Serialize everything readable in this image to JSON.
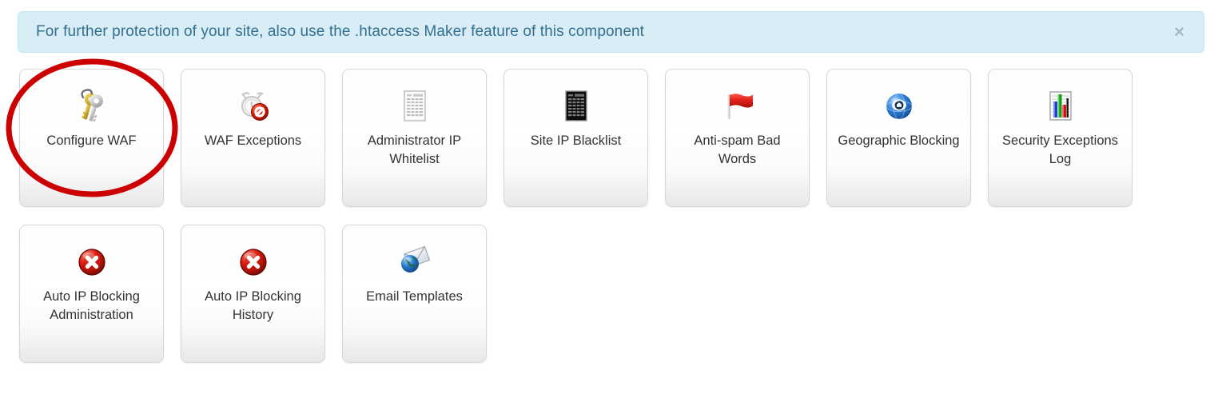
{
  "alert": {
    "message": "For further protection of your site, also use the .htaccess Maker feature of this component",
    "close_label": "×",
    "background_color": "#d9edf7",
    "border_color": "#bce8f1",
    "text_color": "#31708f"
  },
  "annotation": {
    "shape": "ellipse",
    "color": "#cc0000",
    "targets": "Configure WAF"
  },
  "tiles": [
    {
      "label": "Configure WAF",
      "icon": "keys-icon"
    },
    {
      "label": "WAF Exceptions",
      "icon": "alarm-clock-blocked-icon"
    },
    {
      "label": "Administrator IP Whitelist",
      "icon": "white-list-document-icon"
    },
    {
      "label": "Site IP Blacklist",
      "icon": "black-list-document-icon"
    },
    {
      "label": "Anti-spam Bad Words",
      "icon": "red-flag-icon"
    },
    {
      "label": "Geographic Blocking",
      "icon": "blue-globe-icon"
    },
    {
      "label": "Security Exceptions Log",
      "icon": "bar-chart-document-icon"
    },
    {
      "label": "Auto IP Blocking Administration",
      "icon": "red-x-circle-icon"
    },
    {
      "label": "Auto IP Blocking History",
      "icon": "red-x-circle-icon"
    },
    {
      "label": "Email Templates",
      "icon": "envelope-globe-icon"
    }
  ]
}
